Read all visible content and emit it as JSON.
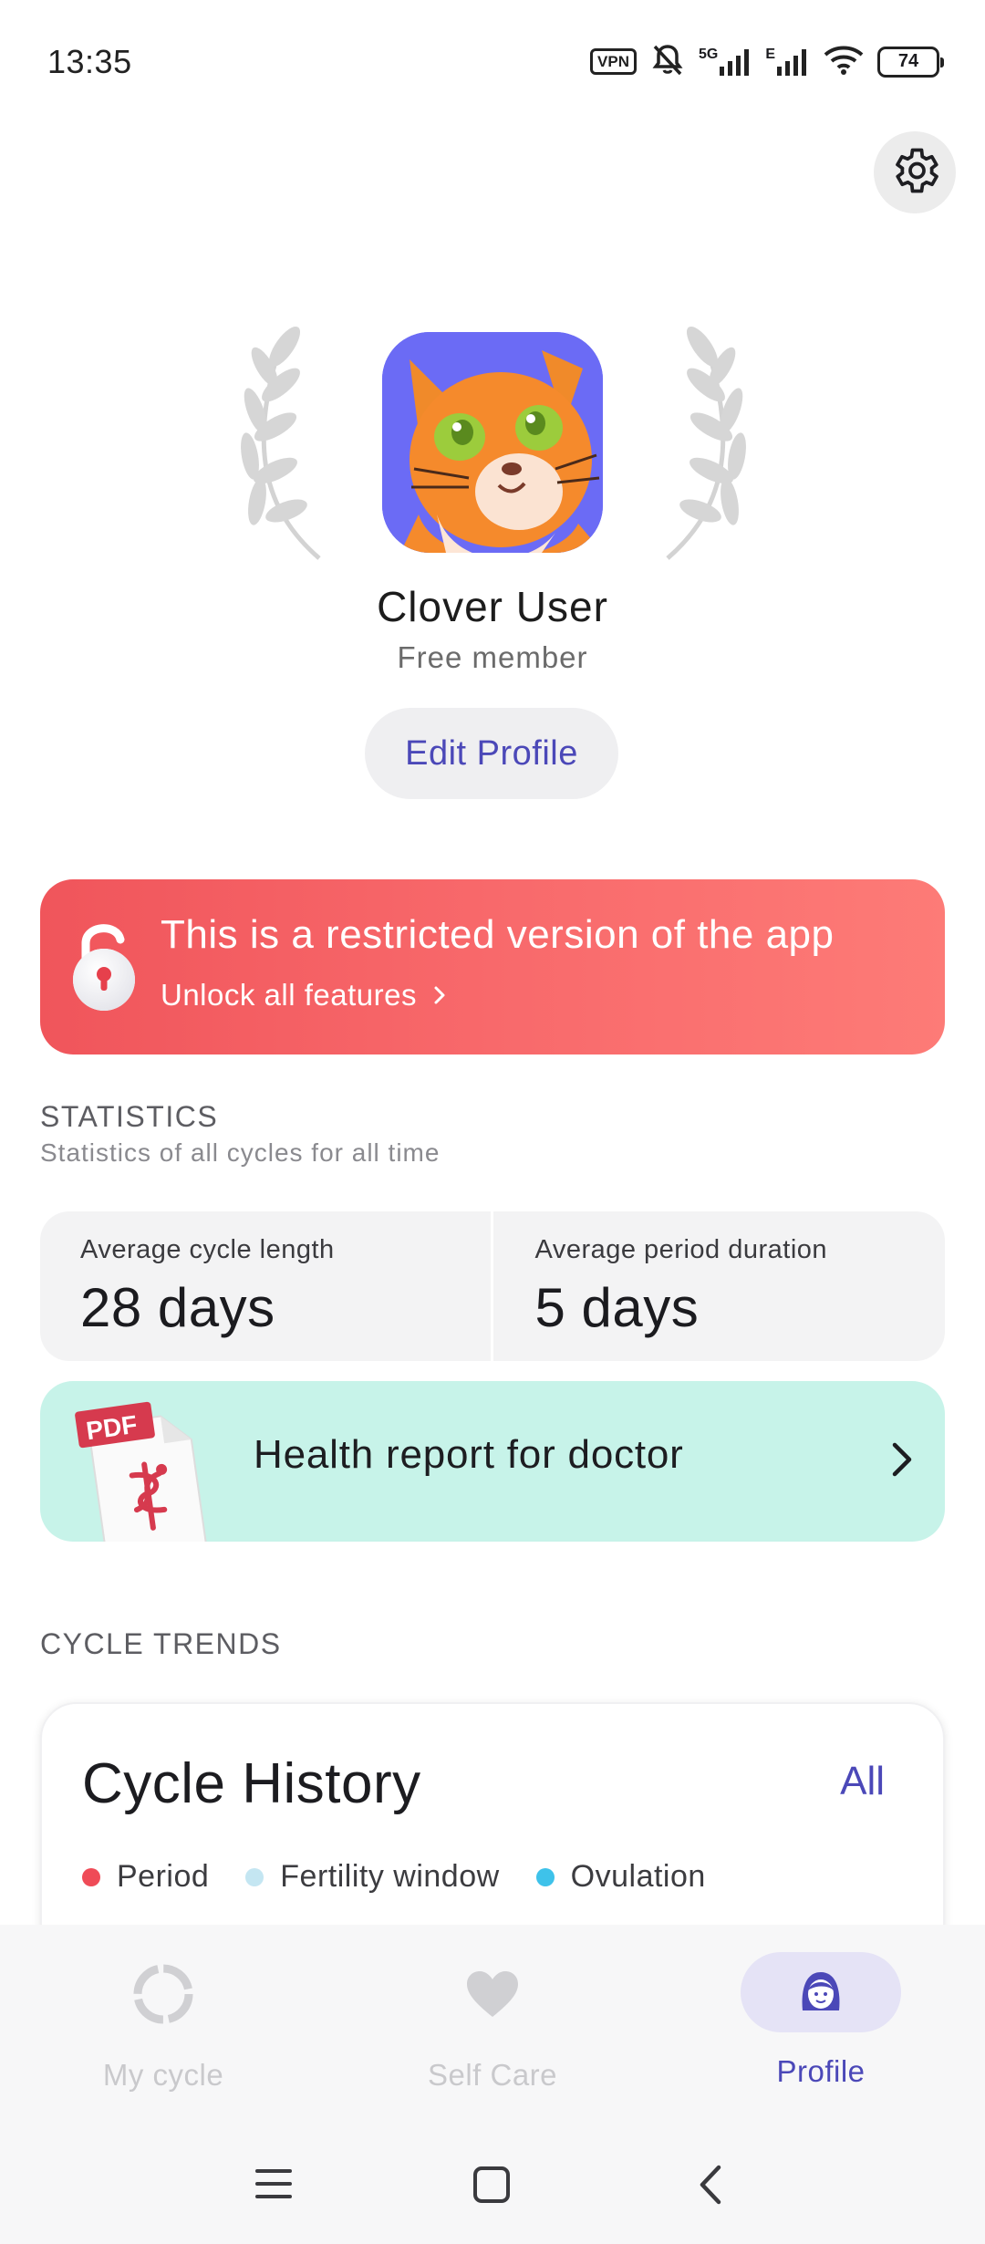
{
  "status_bar": {
    "time": "13:35",
    "vpn": "VPN",
    "network_5g": "5G",
    "network_e": "E",
    "battery": "74"
  },
  "profile": {
    "name": "Clover User",
    "tier": "Free member",
    "edit_label": "Edit Profile"
  },
  "banner": {
    "title": "This is a restricted version of the app",
    "link": "Unlock all features"
  },
  "statistics": {
    "title": "STATISTICS",
    "subtitle": "Statistics of all cycles for all time",
    "items": [
      {
        "label": "Average cycle length",
        "value": "28 days"
      },
      {
        "label": "Average period duration",
        "value": "5 days"
      }
    ]
  },
  "health_report": {
    "badge": "PDF",
    "label": "Health report for doctor"
  },
  "cycle_trends": {
    "title": "CYCLE TRENDS",
    "card_title": "Cycle History",
    "all_label": "All",
    "legend": [
      {
        "label": "Period",
        "color": "#ef4b57"
      },
      {
        "label": "Fertility window",
        "color": "#c4e6f2"
      },
      {
        "label": "Ovulation",
        "color": "#3ec2ea"
      }
    ]
  },
  "bottom_nav": {
    "items": [
      {
        "label": "My cycle",
        "icon": "cycle-ring-icon"
      },
      {
        "label": "Self Care",
        "icon": "heart-icon"
      },
      {
        "label": "Profile",
        "icon": "profile-face-icon"
      }
    ],
    "active_index": 2,
    "accent": "#4b48b8"
  }
}
